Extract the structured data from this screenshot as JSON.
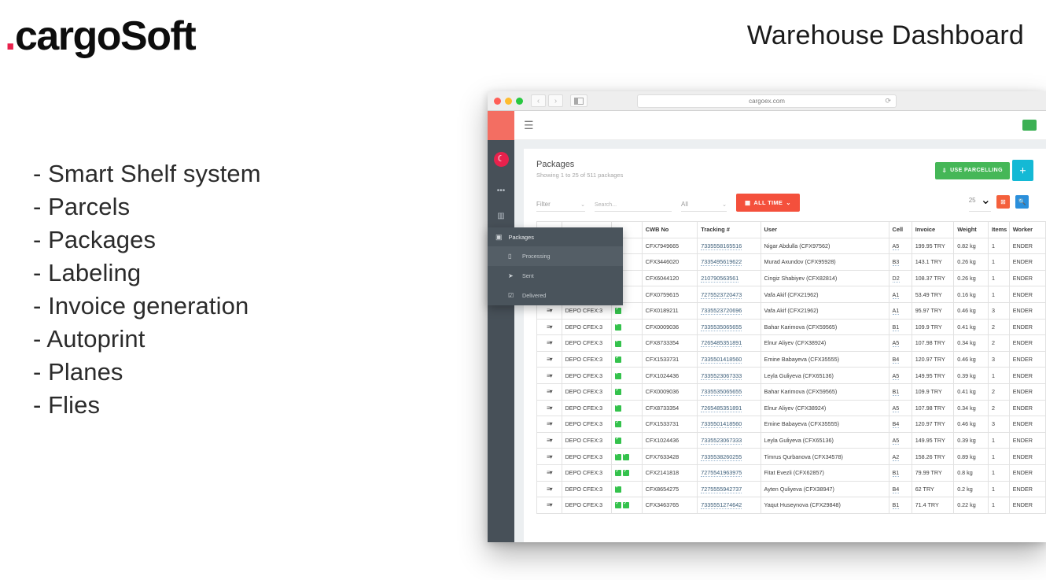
{
  "slide": {
    "logo_text": "cargoSoft",
    "logo_dot": ".",
    "logo_dot_color": "#e8214c",
    "deck_title": "Warehouse Dashboard",
    "features": [
      "- Smart Shelf system",
      "- Parcels",
      "- Packages",
      "- Labeling",
      "- Invoice generation",
      "- Autoprint",
      "- Planes",
      "- Flies"
    ]
  },
  "browser": {
    "url": "cargoex.com",
    "reload_icon": "reload-icon",
    "back_icon": "‹",
    "forward_icon": "›",
    "sidebar_toggle_icon": "sidebar-toggle-icon"
  },
  "app": {
    "hamburger_icon": "hamburger-icon",
    "sidebar": {
      "logo_color": "#f36e62",
      "flag_glyph": "☾",
      "flag_color": "#e8214c",
      "items": [
        {
          "name": "more-icon",
          "glyph": "•••"
        },
        {
          "name": "barcode-icon",
          "glyph": "▥"
        },
        {
          "name": "warehouse-icon",
          "glyph": "🏢"
        },
        {
          "name": "packages-icon",
          "glyph": "📦"
        }
      ]
    },
    "page": {
      "title": "Packages",
      "subtitle": "Showing 1 to 25 of 511 packages",
      "use_parcelling_label": "USE PARCELLING",
      "use_parcelling_icon": "download-box-icon",
      "add_button_icon": "plus-icon"
    },
    "filters": {
      "filter_label": "Filter",
      "filter_caret": "⌄",
      "search_placeholder": "Search...",
      "all_label": "All",
      "all_caret": "⌄",
      "alltime_label": "ALL TIME",
      "alltime_caret": "⌄",
      "calendar_icon": "calendar-icon",
      "page_size": "25",
      "page_size_caret": "⌄",
      "clear_icon": "clear-icon",
      "search_icon": "search-icon"
    },
    "dropdown": {
      "header": "Packages",
      "header_icon": "packages-icon",
      "items": [
        {
          "label": "Processing",
          "icon": "box-icon",
          "glyph": "▯",
          "active": true
        },
        {
          "label": "Sent",
          "icon": "plane-icon",
          "glyph": "➤",
          "active": false
        },
        {
          "label": "Delivered",
          "icon": "check-box-icon",
          "glyph": "☑",
          "active": false
        }
      ]
    },
    "table": {
      "columns": [
        "",
        "",
        "",
        "CWB No",
        "Tracking #",
        "User",
        "Cell",
        "Invoice",
        "Weight",
        "Items",
        "Worker"
      ],
      "headers": {
        "cwb": "CWB No",
        "tracking": "Tracking #",
        "user": "User",
        "cell": "Cell",
        "invoice": "Invoice",
        "weight": "Weight",
        "items": "Items",
        "worker": "Worker"
      },
      "row_menu_icon": "row-menu-icon",
      "depo_label": "DEPO CFEX:3",
      "rows": [
        {
          "depo": "DEPO CFEX:3",
          "checks": 1,
          "cwb": "CFX7949665",
          "tracking": "7335558165516",
          "user": "Nigar Abdulla (CFX97562)",
          "cell": "A5",
          "invoice": "199.95 TRY",
          "weight": "0.82 kg",
          "items": "1",
          "worker": "ENDER"
        },
        {
          "depo": "DEPO CFEX:3",
          "checks": 1,
          "cwb": "CFX3446020",
          "tracking": "7335495619622",
          "user": "Murad Axundov (CFX95928)",
          "cell": "B3",
          "invoice": "143.1 TRY",
          "weight": "0.26 kg",
          "items": "1",
          "worker": "ENDER"
        },
        {
          "depo": "DEPO CFEX:3",
          "checks": 1,
          "cwb": "CFX6044120",
          "tracking": "210790563561",
          "user": "Cingiz Shabiyev (CFX82814)",
          "cell": "D2",
          "invoice": "108.37 TRY",
          "weight": "0.26 kg",
          "items": "1",
          "worker": "ENDER"
        },
        {
          "depo": "DEPO CFEX:3",
          "checks": 1,
          "cwb": "CFX0759615",
          "tracking": "7275523720473",
          "user": "Vafa Akif (CFX21962)",
          "cell": "A1",
          "invoice": "53.49 TRY",
          "weight": "0.16 kg",
          "items": "1",
          "worker": "ENDER"
        },
        {
          "depo": "DEPO CFEX:3",
          "checks": 1,
          "cwb": "CFX0189211",
          "tracking": "7335523720696",
          "user": "Vafa Akif (CFX21962)",
          "cell": "A1",
          "invoice": "95.97 TRY",
          "weight": "0.46 kg",
          "items": "3",
          "worker": "ENDER"
        },
        {
          "depo": "DEPO CFEX:3",
          "checks": 1,
          "cwb": "CFX0009036",
          "tracking": "7335535065655",
          "user": "Bahar Karimova (CFX59565)",
          "cell": "B1",
          "invoice": "109.9 TRY",
          "weight": "0.41 kg",
          "items": "2",
          "worker": "ENDER"
        },
        {
          "depo": "DEPO CFEX:3",
          "checks": 1,
          "cwb": "CFX8733354",
          "tracking": "7265485351891",
          "user": "Elnur Aliyev (CFX38924)",
          "cell": "A5",
          "invoice": "107.98 TRY",
          "weight": "0.34 kg",
          "items": "2",
          "worker": "ENDER"
        },
        {
          "depo": "DEPO CFEX:3",
          "checks": 1,
          "cwb": "CFX1533731",
          "tracking": "7335501418560",
          "user": "Emine Babayeva (CFX35555)",
          "cell": "B4",
          "invoice": "120.97 TRY",
          "weight": "0.46 kg",
          "items": "3",
          "worker": "ENDER"
        },
        {
          "depo": "DEPO CFEX:3",
          "checks": 1,
          "cwb": "CFX1024436",
          "tracking": "7335523067333",
          "user": "Leyla Guliyeva (CFX65136)",
          "cell": "A5",
          "invoice": "149.95 TRY",
          "weight": "0.39 kg",
          "items": "1",
          "worker": "ENDER"
        },
        {
          "depo": "DEPO CFEX:3",
          "checks": 1,
          "cwb": "CFX0009036",
          "tracking": "7335535065655",
          "user": "Bahar Karimova (CFX59565)",
          "cell": "B1",
          "invoice": "109.9 TRY",
          "weight": "0.41 kg",
          "items": "2",
          "worker": "ENDER"
        },
        {
          "depo": "DEPO CFEX:3",
          "checks": 1,
          "cwb": "CFX8733354",
          "tracking": "7265485351891",
          "user": "Elnur Aliyev (CFX38924)",
          "cell": "A5",
          "invoice": "107.98 TRY",
          "weight": "0.34 kg",
          "items": "2",
          "worker": "ENDER"
        },
        {
          "depo": "DEPO CFEX:3",
          "checks": 1,
          "cwb": "CFX1533731",
          "tracking": "7335501418560",
          "user": "Emine Babayeva (CFX35555)",
          "cell": "B4",
          "invoice": "120.97 TRY",
          "weight": "0.46 kg",
          "items": "3",
          "worker": "ENDER"
        },
        {
          "depo": "DEPO CFEX:3",
          "checks": 1,
          "cwb": "CFX1024436",
          "tracking": "7335523067333",
          "user": "Leyla Guliyeva (CFX65136)",
          "cell": "A5",
          "invoice": "149.95 TRY",
          "weight": "0.39 kg",
          "items": "1",
          "worker": "ENDER"
        },
        {
          "depo": "DEPO CFEX:3",
          "checks": 2,
          "cwb": "CFX7633428",
          "tracking": "7335538260255",
          "user": "Timrus Qurbanova (CFX34578)",
          "cell": "A2",
          "invoice": "158.26 TRY",
          "weight": "0.89 kg",
          "items": "1",
          "worker": "ENDER"
        },
        {
          "depo": "DEPO CFEX:3",
          "checks": 2,
          "cwb": "CFX2141818",
          "tracking": "7275541963975",
          "user": "Fitat Evezli (CFX62857)",
          "cell": "B1",
          "invoice": "79.99 TRY",
          "weight": "0.8 kg",
          "items": "1",
          "worker": "ENDER"
        },
        {
          "depo": "DEPO CFEX:3",
          "checks": 1,
          "cwb": "CFX8654275",
          "tracking": "7275555942737",
          "user": "Ayten Quliyeva (CFX38947)",
          "cell": "B4",
          "invoice": "62 TRY",
          "weight": "0.2 kg",
          "items": "1",
          "worker": "ENDER"
        },
        {
          "depo": "DEPO CFEX:3",
          "checks": 2,
          "cwb": "CFX3463765",
          "tracking": "7335551274642",
          "user": "Yaqut Huseynova (CFX29848)",
          "cell": "B1",
          "invoice": "71.4 TRY",
          "weight": "0.22 kg",
          "items": "1",
          "worker": "ENDER"
        }
      ]
    }
  }
}
